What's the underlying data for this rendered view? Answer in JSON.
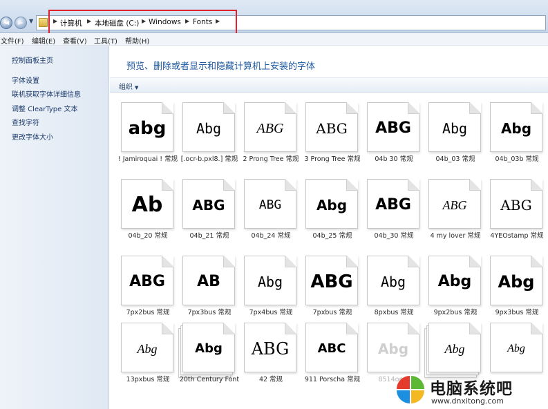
{
  "breadcrumb": [
    "计算机",
    "本地磁盘 (C:)",
    "Windows",
    "Fonts"
  ],
  "menu": [
    "文件(F)",
    "编辑(E)",
    "查看(V)",
    "工具(T)",
    "帮助(H)"
  ],
  "left_links": [
    "控制面板主页",
    "字体设置",
    "联机获取字体详细信息",
    "调整 ClearType 文本",
    "查找字符",
    "更改字体大小"
  ],
  "headline": "预览、删除或者显示和隐藏计算机上安装的字体",
  "toolbar": {
    "organize": "组织"
  },
  "fonts": [
    {
      "sample": "abg",
      "style": "s-heavy",
      "name": "! Jamiroquai ! 常规"
    },
    {
      "sample": "Abg",
      "style": "s-mono",
      "name": "[.ocr-b.pxl8.] 常规"
    },
    {
      "sample": "ABG",
      "style": "s-italic",
      "name": "2 Prong Tree 常规"
    },
    {
      "sample": "ABG",
      "style": "s-serif",
      "name": "3 Prong Tree 常规"
    },
    {
      "sample": "ABG",
      "style": "s-heavy",
      "name": "04b 30 常规"
    },
    {
      "sample": "Abg",
      "style": "s-mono",
      "name": "04b_03 常规"
    },
    {
      "sample": "Abg",
      "style": "s-heavy",
      "name": "04b_03b 常规"
    },
    {
      "sample": "Ab",
      "style": "s-heavy",
      "name": "04b_20 常规"
    },
    {
      "sample": "ABG",
      "style": "s-heavy",
      "name": "04b_21 常规"
    },
    {
      "sample": "ABG",
      "style": "s-mono",
      "name": "04b_24 常规"
    },
    {
      "sample": "Abg",
      "style": "s-heavy",
      "name": "04b_25 常规"
    },
    {
      "sample": "ABG",
      "style": "s-heavy",
      "name": "04b_30 常规"
    },
    {
      "sample": "ABG",
      "style": "s-italic",
      "name": "4 my lover 常规"
    },
    {
      "sample": "ABG",
      "style": "s-serif",
      "name": "4YEOstamp 常规"
    },
    {
      "sample": "ABG",
      "style": "s-heavy",
      "name": "7px2bus 常规"
    },
    {
      "sample": "AB",
      "style": "s-heavy",
      "name": "7px3bus 常规"
    },
    {
      "sample": "Abg",
      "style": "s-mono",
      "name": "7px4bus 常规"
    },
    {
      "sample": "ABG",
      "style": "s-heavy",
      "name": "7pxbus 常规"
    },
    {
      "sample": "Abg",
      "style": "s-mono",
      "name": "8pxbus 常规"
    },
    {
      "sample": "Abg",
      "style": "s-heavy",
      "name": "9px2bus 常规"
    },
    {
      "sample": "Abg",
      "style": "s-heavy",
      "name": "9px3bus 常规"
    },
    {
      "sample": "Abg",
      "style": "s-italic",
      "name": "13pxbus 常规"
    },
    {
      "sample": "Abg",
      "style": "s-heavy",
      "name": "20th Century Font"
    },
    {
      "sample": "ABG",
      "style": "s-serif",
      "name": "42 常规"
    },
    {
      "sample": "ABC",
      "style": "s-heavy",
      "name": "911 Porscha 常规"
    },
    {
      "sample": "Abg",
      "style": "s-heavy",
      "name": "8514oem"
    },
    {
      "sample": "Abg",
      "style": "s-italic",
      "name": ""
    },
    {
      "sample": "Abg",
      "style": "s-italic",
      "name": ""
    }
  ],
  "watermark": {
    "title": "电脑系统吧",
    "url": "www.dnxitong.com"
  },
  "colors": {
    "highlight_box": "#e0202a",
    "headline": "#1e5aa0"
  }
}
